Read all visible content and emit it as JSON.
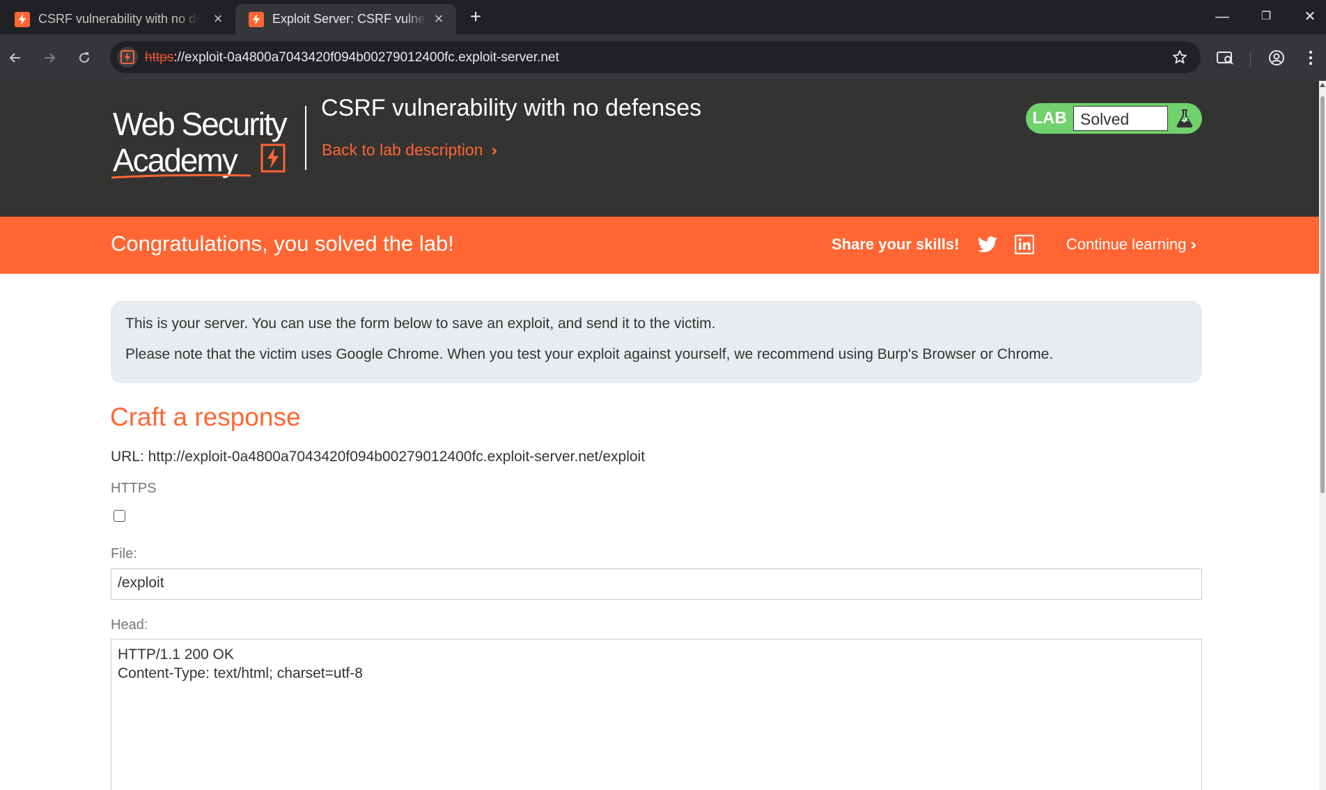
{
  "browser": {
    "tabs": [
      {
        "title": "CSRF vulnerability with no defenses",
        "active": false
      },
      {
        "title": "Exploit Server: CSRF vulnerability with no defenses",
        "active": true
      }
    ],
    "url_scheme": "https",
    "url_rest": "://exploit-0a4800a7043420f094b00279012400fc.exploit-server.net",
    "window_buttons": {
      "minimize": "—",
      "restore": "❐",
      "close": "✕"
    }
  },
  "header": {
    "logo_line1": "Web Security",
    "logo_line2": "Academy",
    "lab_title": "CSRF vulnerability with no defenses",
    "back_link": "Back to lab description",
    "status_badge": {
      "lab_label": "LAB",
      "status": "Solved",
      "color": "#70d16d"
    }
  },
  "banner": {
    "congrats": "Congratulations, you solved the lab!",
    "share_label": "Share your skills!",
    "continue_link": "Continue learning",
    "color": "#ff6633"
  },
  "info": {
    "line1": "This is your server. You can use the form below to save an exploit, and send it to the victim.",
    "line2": "Please note that the victim uses Google Chrome. When you test your exploit against yourself, we recommend using Burp's Browser or Chrome."
  },
  "form": {
    "title": "Craft a response",
    "url_line": "URL: http://exploit-0a4800a7043420f094b00279012400fc.exploit-server.net/exploit",
    "https_label": "HTTPS",
    "https_checked": false,
    "file_label": "File:",
    "file_value": "/exploit",
    "head_label": "Head:",
    "head_lines": [
      "HTTP/1.1 200 OK",
      "Content-Type: text/html; charset=utf-8"
    ]
  },
  "icons": [
    "site-favicon-icon",
    "close-icon",
    "plus-icon",
    "back-arrow-icon",
    "forward-arrow-icon",
    "reload-icon",
    "star-icon",
    "search-tabs-icon",
    "profile-icon",
    "kebab-menu-icon",
    "flask-icon",
    "twitter-icon",
    "linkedin-icon",
    "double-chevron-icon"
  ]
}
